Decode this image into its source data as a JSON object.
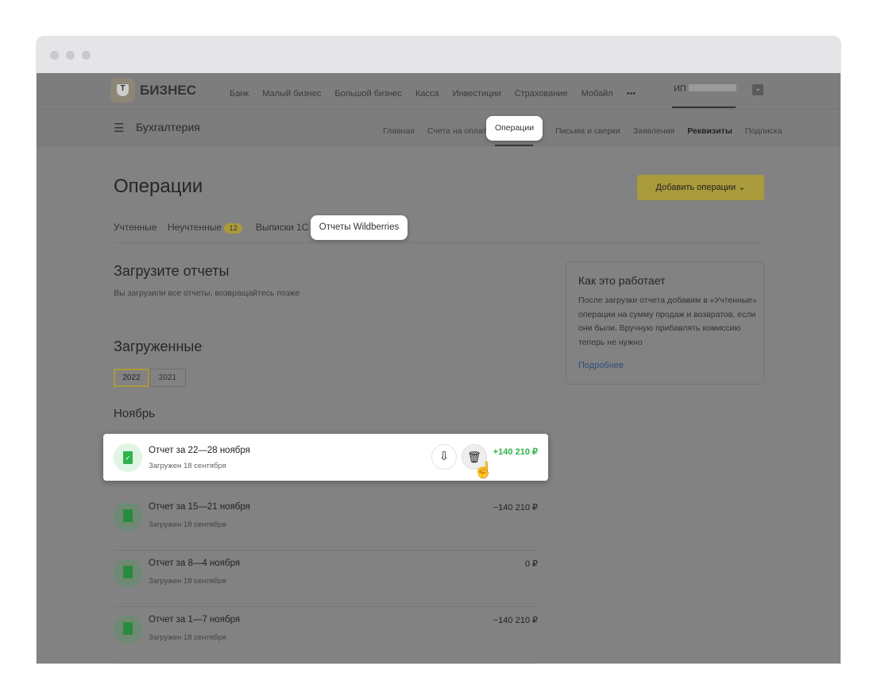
{
  "header": {
    "logo_letter": "Т",
    "brand": "БИЗНЕС",
    "nav": [
      "Банк",
      "Малый бизнес",
      "Большой бизнес",
      "Касса",
      "Инвестиции",
      "Страхование",
      "Мобайл",
      "•••"
    ],
    "account": "ИП"
  },
  "subheader": {
    "section": "Бухгалтерия",
    "nav": [
      "Главная",
      "Счета на оплату",
      "Операции",
      "Письма и сверки",
      "Заявления",
      "Реквизиты",
      "Подписка"
    ]
  },
  "page": {
    "title": "Операции",
    "add_button": "Добавить операции",
    "tabs": [
      {
        "label": "Учтенные"
      },
      {
        "label": "Неучтенные",
        "badge": "12"
      },
      {
        "label": "Выписки 1С"
      },
      {
        "label": "Отчеты Wildberries"
      }
    ]
  },
  "upload": {
    "title": "Загрузите отчеты",
    "subtitle": "Вы загрузили все отчеты, возвращайтесь позже"
  },
  "uploaded": {
    "title": "Загруженные",
    "years": [
      "2022",
      "2021"
    ],
    "month": "Ноябрь",
    "reports": [
      {
        "title": "Отчет за 22—28 ноября",
        "subtitle": "Загружен 18 сентября",
        "amount": "+140 210 ₽"
      },
      {
        "title": "Отчет за 15—21 ноября",
        "subtitle": "Загружен 18 сентября",
        "amount": "−140 210 ₽"
      },
      {
        "title": "Отчет за 8—4 ноября",
        "subtitle": "Загружен 18 сентября",
        "amount": "0 ₽"
      },
      {
        "title": "Отчет за 1—7 ноября",
        "subtitle": "Загружен 18 сентября",
        "amount": "−140 210 ₽"
      }
    ]
  },
  "info": {
    "title": "Как это работает",
    "text": "После загрузки отчета добавим в «Учтенные» операции на сумму продаж и возвратов, если они были. Вручную прибавлять комиссию теперь не нужно",
    "link": "Подробнее"
  },
  "colors": {
    "accent": "#c8b03a",
    "positive": "#2fb34a"
  }
}
